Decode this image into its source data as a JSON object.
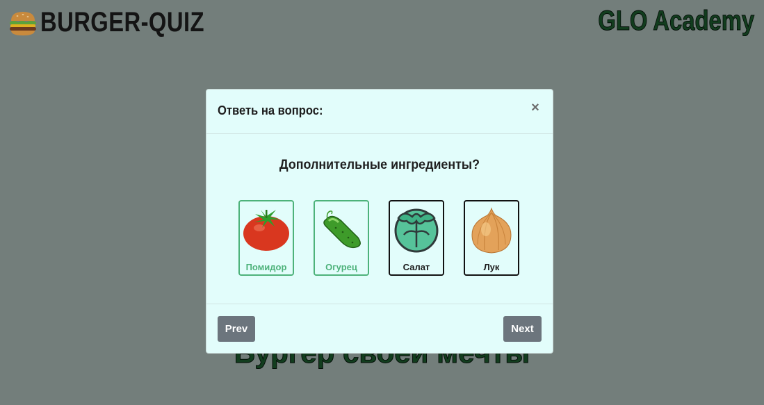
{
  "header": {
    "logo_text": "BURGER-QUIZ",
    "academy_text": "GLO Academy",
    "logo_icon": "burger-icon"
  },
  "hero": {
    "text": "Бургер своей мечты"
  },
  "modal": {
    "title": "Ответь на вопрос:",
    "close_label": "×",
    "question": "Дополнительные ингредиенты?",
    "answers": [
      {
        "label": "Помидор",
        "icon": "tomato-icon",
        "selected": true
      },
      {
        "label": "Огурец",
        "icon": "cucumber-icon",
        "selected": true
      },
      {
        "label": "Салат",
        "icon": "lettuce-icon",
        "selected": false
      },
      {
        "label": "Лук",
        "icon": "onion-icon",
        "selected": false
      }
    ],
    "prev_label": "Prev",
    "next_label": "Next"
  },
  "colors": {
    "background": "#737e7b",
    "modal_bg": "#e2fdfb",
    "selected_accent": "#4db27a",
    "button": "#6c757d"
  }
}
